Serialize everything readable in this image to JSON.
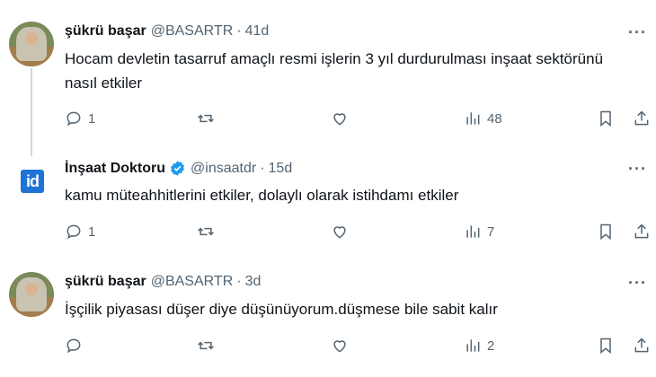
{
  "tweets": [
    {
      "name": "şükrü başar",
      "handle": "@BASARTR",
      "separator": "·",
      "time": "41d",
      "text": "Hocam devletin tasarruf amaçlı resmi işlerin 3 yıl durdurulması inşaat sektörünü nasıl etkiler",
      "replies": "1",
      "retweets": "",
      "likes": "",
      "views": "48",
      "verified": false,
      "more_label": "···"
    },
    {
      "name": "İnşaat Doktoru",
      "handle": "@insaatdr",
      "separator": "·",
      "time": "15d",
      "text": "kamu müteahhitlerini etkiler, dolaylı olarak istihdamı etkiler",
      "replies": "1",
      "retweets": "",
      "likes": "",
      "views": "7",
      "verified": true,
      "avatar_text": "id",
      "more_label": "···"
    },
    {
      "name": "şükrü başar",
      "handle": "@BASARTR",
      "separator": "·",
      "time": "3d",
      "text": "İşçilik piyasası düşer diye düşünüyorum.düşmese bile sabit kalır",
      "replies": "",
      "retweets": "",
      "likes": "",
      "views": "2",
      "verified": false,
      "more_label": "···"
    }
  ],
  "colors": {
    "text": "#0f1419",
    "muted": "#536471",
    "verified": "#1d9bf0",
    "thread_line": "#cfd9de"
  }
}
